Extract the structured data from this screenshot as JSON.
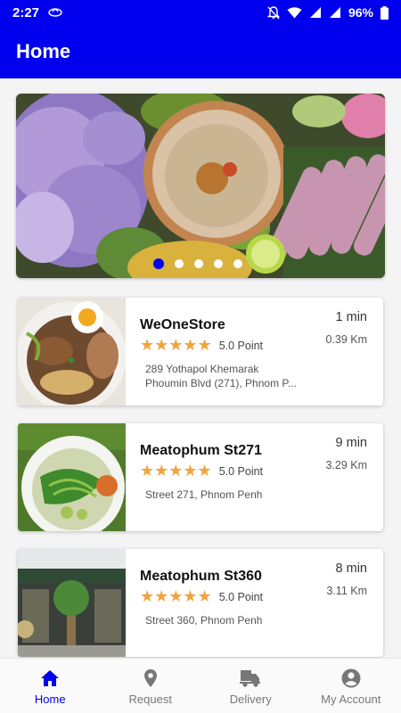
{
  "status_bar": {
    "time": "2:27",
    "battery": "96%",
    "icons": [
      "app-notification-icon",
      "notifications-off-icon",
      "wifi-icon",
      "signal-icon",
      "signal-icon",
      "battery-icon"
    ]
  },
  "app_bar": {
    "title": "Home"
  },
  "banner": {
    "slide_count": 5,
    "active_slide": 1
  },
  "stores": [
    {
      "name": "WeOneStore",
      "stars": "★★★★★",
      "rating": "5.0 Point",
      "address_lines": [
        "289 Yothapol Khemarak",
        "Phoumin Blvd (271), Phnom P..."
      ],
      "time": "1 min",
      "distance": "0.39 Km"
    },
    {
      "name": "Meatophum St271",
      "stars": "★★★★★",
      "rating": "5.0 Point",
      "address_lines": [
        "Street 271, Phnom Penh"
      ],
      "time": "9 min",
      "distance": "3.29 Km"
    },
    {
      "name": "Meatophum St360",
      "stars": "★★★★★",
      "rating": "5.0 Point",
      "address_lines": [
        "Street 360, Phnom Penh"
      ],
      "time": "8 min",
      "distance": "3.11 Km"
    }
  ],
  "bottom_nav": [
    {
      "label": "Home",
      "icon": "home-icon",
      "active": true
    },
    {
      "label": "Request",
      "icon": "location-pin-icon",
      "active": false
    },
    {
      "label": "Delivery",
      "icon": "delivery-truck-icon",
      "active": false
    },
    {
      "label": "My Account",
      "icon": "account-circle-icon",
      "active": false
    }
  ],
  "colors": {
    "primary": "#0000EE",
    "star": "#F3A33A",
    "inactive_nav": "#777777"
  }
}
